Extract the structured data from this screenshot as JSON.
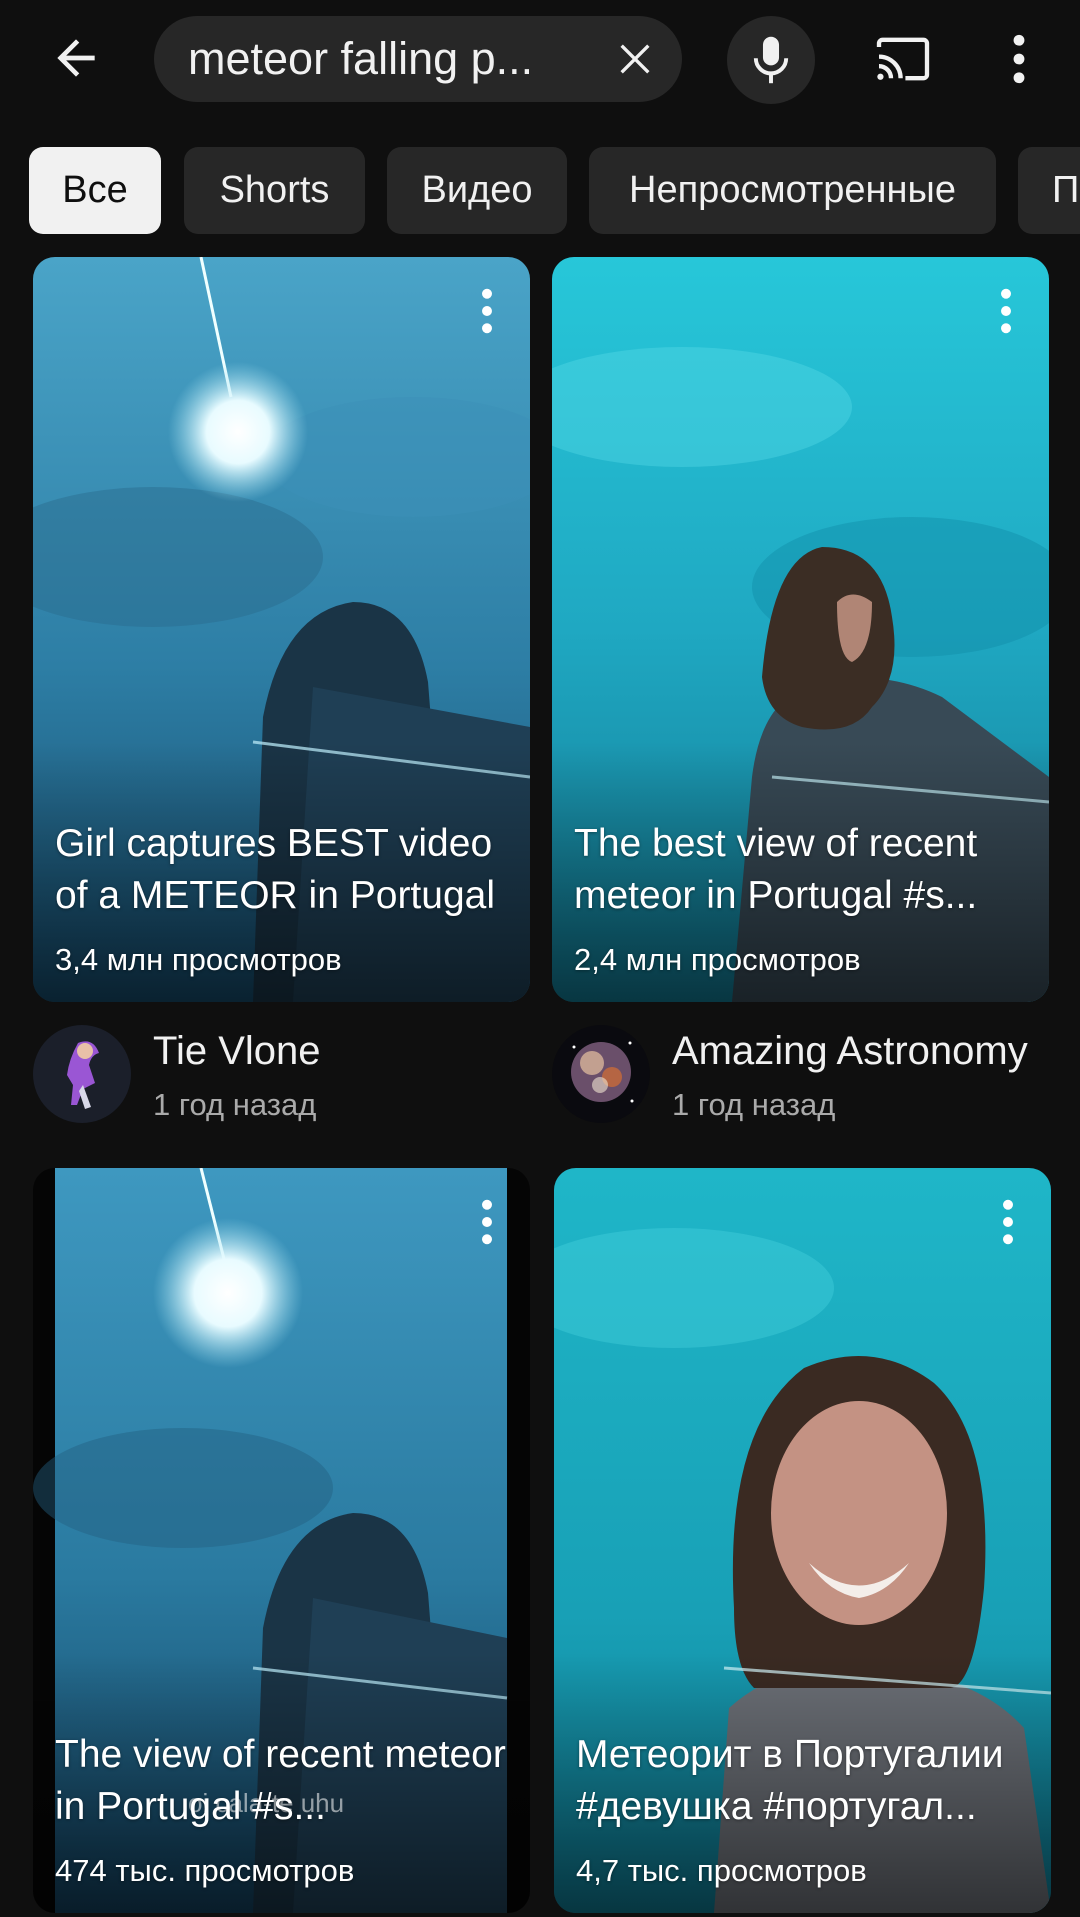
{
  "search": {
    "query": "meteor falling p..."
  },
  "filters": [
    {
      "label": "Все",
      "active": true
    },
    {
      "label": "Shorts",
      "active": false
    },
    {
      "label": "Видео",
      "active": false
    },
    {
      "label": "Непросмотренные",
      "active": false
    },
    {
      "label": "П",
      "active": false
    }
  ],
  "videos": [
    {
      "title": "Girl captures BEST video of a METEOR in Portugal",
      "views": "3,4 млн просмотров",
      "channel": "Tie Vlone",
      "date": "1 год назад"
    },
    {
      "title": "The best view of recent meteor in Portugal #s...",
      "views": "2,4 млн просмотров",
      "channel": "Amazing Astronomy",
      "date": "1 год назад"
    },
    {
      "title": "The view of recent meteor in Portugal #s...",
      "views": "474 тыс. просмотров",
      "caption": "oi cala-te uhu"
    },
    {
      "title": "Метеорит в Португалии #девушка #португал...",
      "views": "4,7 тыс. просмотров"
    }
  ],
  "colors": {
    "background": "#0f0f0f",
    "surface": "#272727",
    "chip_active": "#f1f1f1",
    "text_secondary": "#aaaaaa"
  },
  "icons": [
    "back-arrow-icon",
    "clear-icon",
    "mic-icon",
    "cast-icon",
    "more-vert-icon"
  ]
}
